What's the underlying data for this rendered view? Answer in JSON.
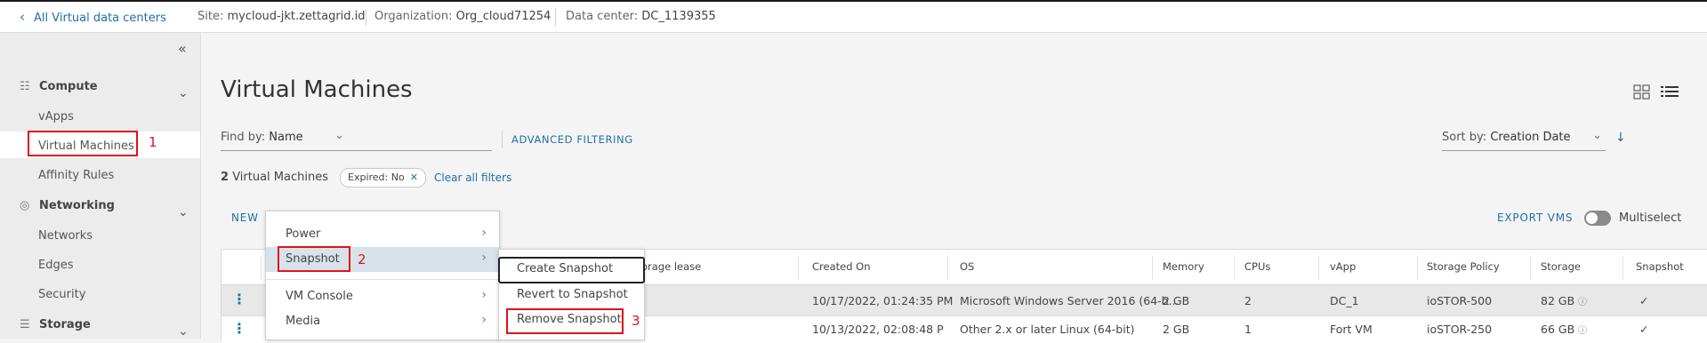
{
  "topbar": {
    "back_label": "All Virtual data centers",
    "site_key": "Site:",
    "site_value": "mycloud-jkt.zettagrid.id",
    "org_key": "Organization:",
    "org_value": "Org_cloud71254",
    "dc_key": "Data center:",
    "dc_value": "DC_1139355"
  },
  "sidebar": {
    "collapse_icon": "double-chevron-left-icon",
    "groups": [
      {
        "label": "Compute",
        "icon": "grid-icon",
        "items": [
          "vApps",
          "Virtual Machines",
          "Affinity Rules"
        ]
      },
      {
        "label": "Networking",
        "icon": "globe-icon",
        "items": [
          "Networks",
          "Edges",
          "Security"
        ]
      },
      {
        "label": "Storage",
        "icon": "database-icon",
        "items": []
      }
    ]
  },
  "annotations": {
    "step1": "1",
    "step2": "2",
    "step3": "3"
  },
  "main": {
    "title": "Virtual Machines",
    "find_by_label": "Find by:",
    "find_by_value": "Name",
    "advanced_filtering": "ADVANCED FILTERING",
    "sort_by_label": "Sort by:",
    "sort_by_value": "Creation Date",
    "count_number": "2",
    "count_label": "Virtual Machines",
    "filter_pill": "Expired: No",
    "clear_all": "Clear all filters",
    "new_label": "NEW",
    "export_label": "EXPORT VMS",
    "multiselect_label": "Multiselect",
    "multiselect_on": false
  },
  "table": {
    "columns": [
      "orage lease",
      "Created On",
      "OS",
      "Memory",
      "CPUs",
      "vApp",
      "Storage Policy",
      "Storage",
      "Snapshot"
    ],
    "rows": [
      {
        "created_on": "10/17/2022, 01:24:35 PM",
        "os": "Microsoft Windows Server 2016 (64-b...",
        "memory": "2 GB",
        "cpus": "2",
        "vapp": "DC_1",
        "storage_policy": "ioSTOR-500",
        "storage": "82 GB",
        "snapshot": "✓"
      },
      {
        "created_on": "10/13/2022, 02:08:48 P",
        "os": "Other 2.x or later Linux (64-bit)",
        "memory": "2 GB",
        "cpus": "1",
        "vapp": "Fort VM",
        "storage_policy": "ioSTOR-250",
        "storage": "66 GB",
        "snapshot": "✓"
      }
    ]
  },
  "context_menu": {
    "items": [
      "Power",
      "Snapshot",
      "VM Console",
      "Media"
    ],
    "submenu": [
      "Create Snapshot",
      "Revert to Snapshot",
      "Remove Snapshot"
    ]
  },
  "colors": {
    "accent": "#1f6fa8",
    "annotation_red": "#e0131a",
    "highlight": "#d8e2ea"
  }
}
